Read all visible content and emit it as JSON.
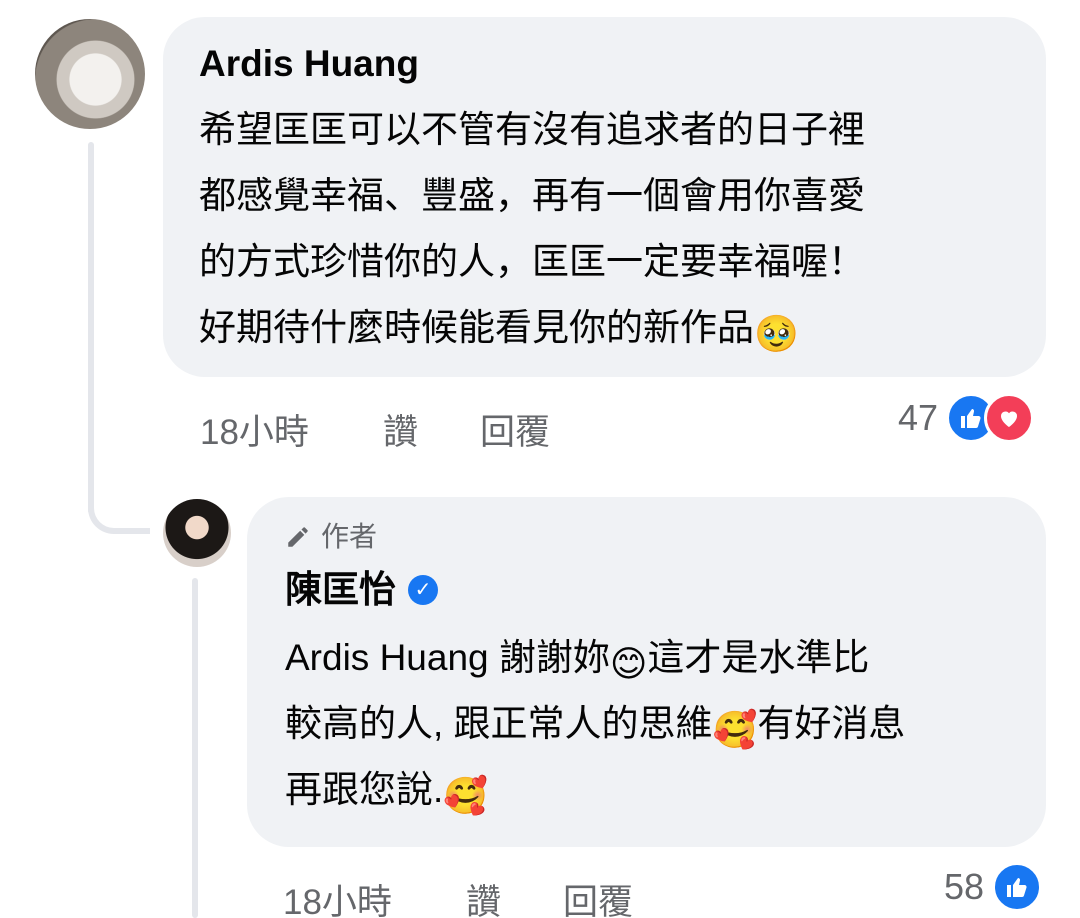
{
  "comment1": {
    "author": "Ardis Huang",
    "text_lines": [
      "希望匡匡可以不管有沒有追求者的日子裡",
      "都感覺幸福、豐盛，再有一個會用你喜愛",
      "的方式珍惜你的人，匡匡一定要幸福喔！",
      "好期待什麼時候能看見你的新作品"
    ],
    "emoji_end": "🥹",
    "time": "18小時",
    "like_label": "讚",
    "reply_label": "回覆",
    "reaction_count": "47",
    "reactions": [
      "like-icon",
      "love-icon"
    ]
  },
  "comment2": {
    "badge_label": "作者",
    "author": "陳匡怡",
    "verified": true,
    "text_line1_a": "Ardis Huang 謝謝妳",
    "emoji_1": "😊",
    "text_line1_b": "這才是水準比",
    "text_line2_a": "較高的人, 跟正常人的思維",
    "emoji_2": "🥰",
    "text_line2_b": "有好消息",
    "text_line3": "再跟您說.",
    "emoji_3": "🥰",
    "time": "18小時",
    "like_label": "讚",
    "reply_label": "回覆",
    "reaction_count": "58",
    "reactions": [
      "like-icon"
    ]
  },
  "colors": {
    "bubble_bg": "#f0f2f5",
    "meta_text": "#65676b",
    "like_blue": "#1877f2",
    "love_red": "#f33e58",
    "thread_line": "#e4e6eb"
  }
}
